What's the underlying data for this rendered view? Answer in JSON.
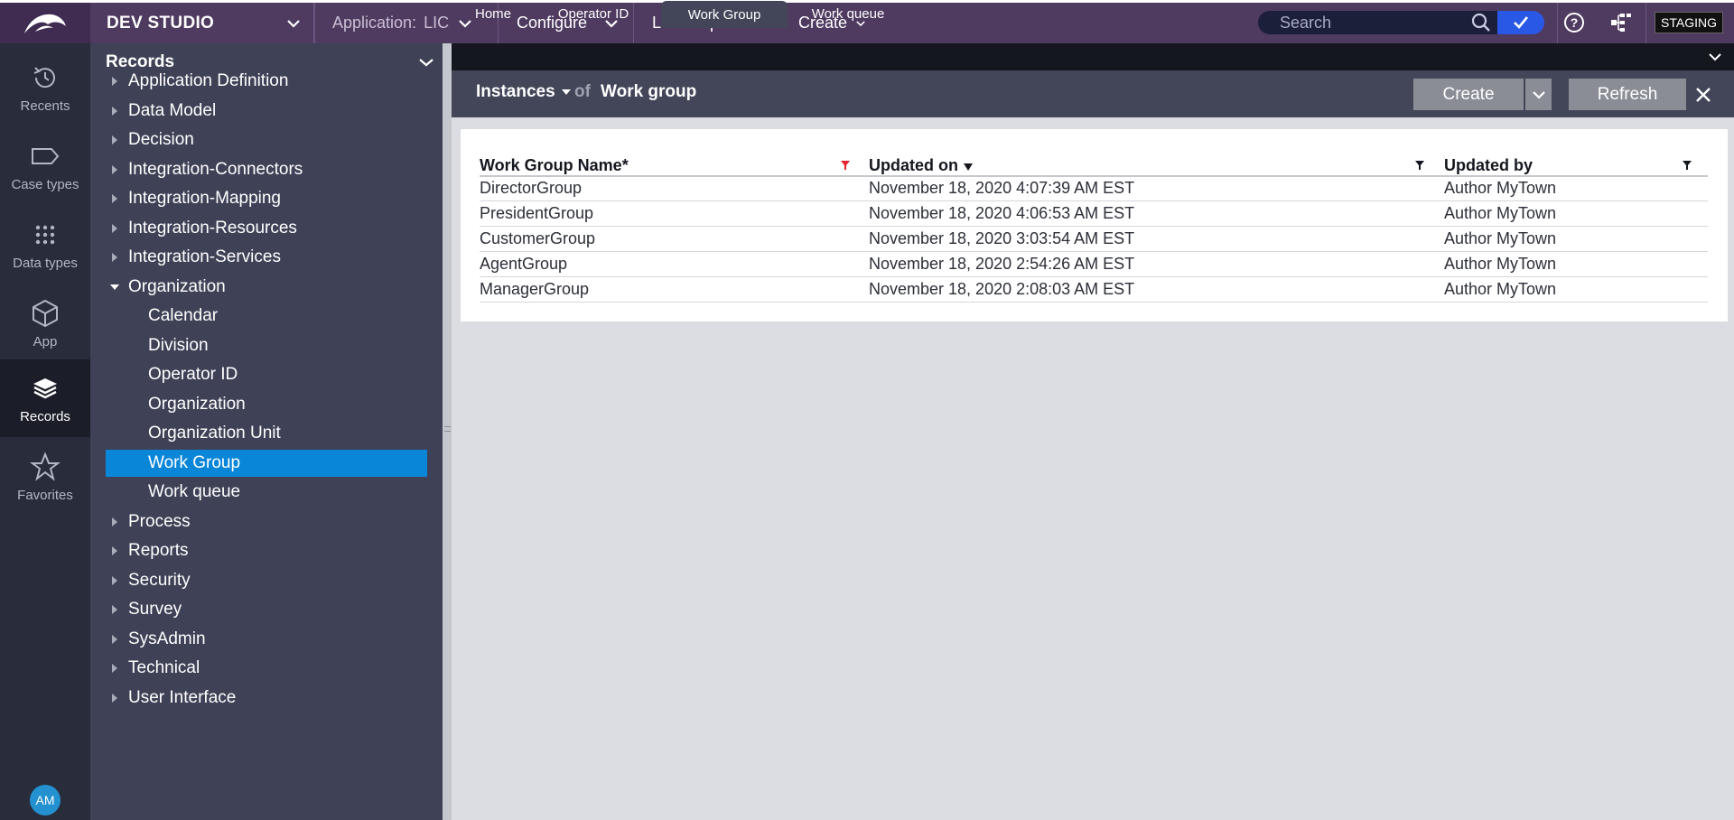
{
  "topbar": {
    "studio_label": "DEV STUDIO",
    "application_label": "Application:",
    "application_value": "LIC",
    "configure_label": "Configure",
    "launch_portal_label": "Launch portal",
    "create_label": "Create",
    "search_placeholder": "Search",
    "environment_badge": "STAGING"
  },
  "rail": {
    "items": [
      {
        "label": "Recents",
        "icon": "history-icon"
      },
      {
        "label": "Case types",
        "icon": "case-types-icon"
      },
      {
        "label": "Data types",
        "icon": "data-types-icon"
      },
      {
        "label": "App",
        "icon": "app-cube-icon"
      },
      {
        "label": "Records",
        "icon": "records-layers-icon",
        "active": true
      },
      {
        "label": "Favorites",
        "icon": "star-icon"
      }
    ],
    "avatar_initials": "AM"
  },
  "records_panel": {
    "title": "Records",
    "tree": [
      {
        "label": "Application Definition",
        "level": 0,
        "state": "collapsed"
      },
      {
        "label": "Data Model",
        "level": 0,
        "state": "collapsed"
      },
      {
        "label": "Decision",
        "level": 0,
        "state": "collapsed"
      },
      {
        "label": "Integration-Connectors",
        "level": 0,
        "state": "collapsed"
      },
      {
        "label": "Integration-Mapping",
        "level": 0,
        "state": "collapsed"
      },
      {
        "label": "Integration-Resources",
        "level": 0,
        "state": "collapsed"
      },
      {
        "label": "Integration-Services",
        "level": 0,
        "state": "collapsed"
      },
      {
        "label": "Organization",
        "level": 0,
        "state": "expanded"
      },
      {
        "label": "Calendar",
        "level": 1
      },
      {
        "label": "Division",
        "level": 1
      },
      {
        "label": "Operator ID",
        "level": 1
      },
      {
        "label": "Organization",
        "level": 1
      },
      {
        "label": "Organization Unit",
        "level": 1
      },
      {
        "label": "Work Group",
        "level": 1,
        "selected": true
      },
      {
        "label": "Work queue",
        "level": 1
      },
      {
        "label": "Process",
        "level": 0,
        "state": "collapsed"
      },
      {
        "label": "Reports",
        "level": 0,
        "state": "collapsed"
      },
      {
        "label": "Security",
        "level": 0,
        "state": "collapsed"
      },
      {
        "label": "Survey",
        "level": 0,
        "state": "collapsed"
      },
      {
        "label": "SysAdmin",
        "level": 0,
        "state": "collapsed"
      },
      {
        "label": "Technical",
        "level": 0,
        "state": "collapsed"
      },
      {
        "label": "User Interface",
        "level": 0,
        "state": "collapsed"
      }
    ]
  },
  "tabs": [
    {
      "label": "Home"
    },
    {
      "label": "Operator ID"
    },
    {
      "label": "Work Group",
      "active": true
    },
    {
      "label": "Work queue"
    }
  ],
  "header": {
    "instances_label": "Instances",
    "of_label": "of",
    "title": "Work group",
    "create_button": "Create",
    "refresh_button": "Refresh"
  },
  "table": {
    "columns": [
      "Work Group Name*",
      "Updated on",
      "Updated by"
    ],
    "rows": [
      [
        "DirectorGroup",
        "November 18, 2020 4:07:39 AM EST",
        "Author MyTown"
      ],
      [
        "PresidentGroup",
        "November 18, 2020 4:06:53 AM EST",
        "Author MyTown"
      ],
      [
        "CustomerGroup",
        "November 18, 2020 3:03:54 AM EST",
        "Author MyTown"
      ],
      [
        "AgentGroup",
        "November 18, 2020 2:54:26 AM EST",
        "Author MyTown"
      ],
      [
        "ManagerGroup",
        "November 18, 2020 2:08:03 AM EST",
        "Author MyTown"
      ]
    ]
  },
  "colors": {
    "topbar": "#4f3a60",
    "rail": "#292c3b",
    "panel": "#3f4256",
    "selection": "#0a86d9",
    "search_go": "#2a58e6",
    "active_filter": "#e8212b"
  }
}
